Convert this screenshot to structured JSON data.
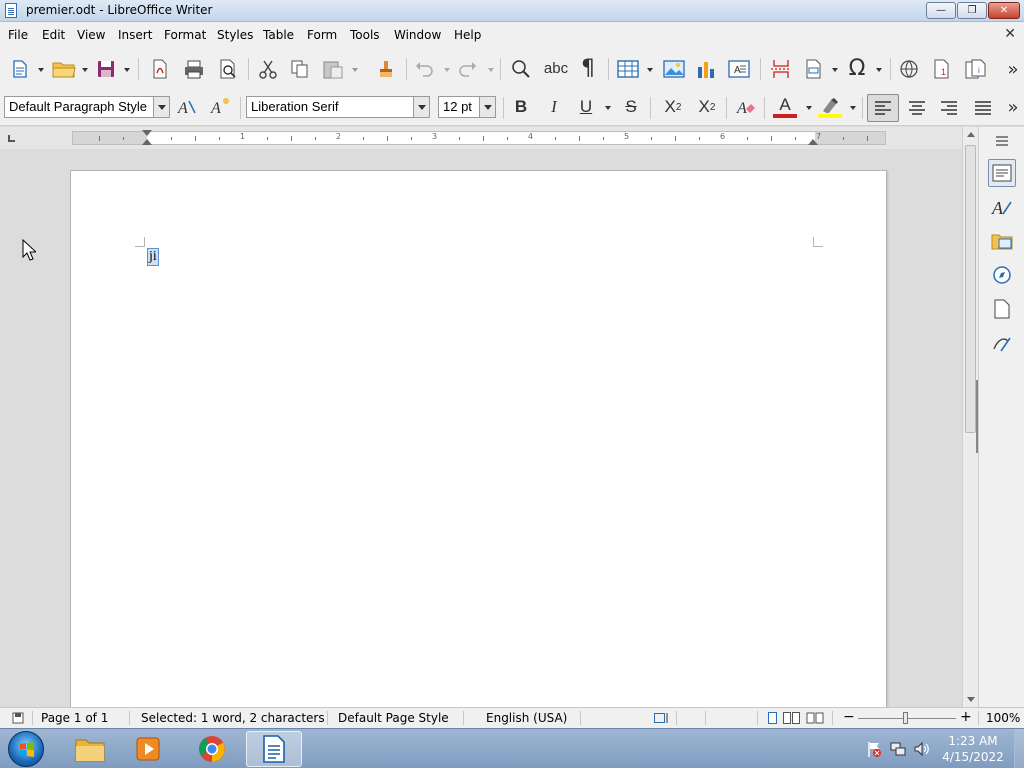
{
  "window": {
    "title": "premier.odt - LibreOffice Writer",
    "minimize_glyph": "—",
    "maximize_glyph": "❐",
    "close_glyph": "✕"
  },
  "menubar": {
    "items": [
      "File",
      "Edit",
      "View",
      "Insert",
      "Format",
      "Styles",
      "Table",
      "Form",
      "Tools",
      "Window",
      "Help"
    ],
    "close_glyph": "✕"
  },
  "toolbar": {
    "more_glyph": "»"
  },
  "formatting": {
    "paragraph_style": "Default Paragraph Style",
    "font_name": "Liberation Serif",
    "font_size": "12 pt",
    "bold_label": "B",
    "italic_label": "I",
    "underline_label": "U",
    "strikethrough_label": "S",
    "superscript_label": "X",
    "superscript_mark": "2",
    "subscript_label": "X",
    "subscript_mark": "2",
    "font_color_label": "A",
    "font_color": "#c9211e",
    "highlight_color": "#ffff00"
  },
  "ruler": {
    "numbers": [
      "1",
      "2",
      "3",
      "4",
      "5",
      "6",
      "7"
    ]
  },
  "document": {
    "selected_text": "ji"
  },
  "statusbar": {
    "page": "Page 1 of 1",
    "selection": "Selected: 1 word, 2 characters",
    "page_style": "Default Page Style",
    "language": "English (USA)",
    "zoom": "100%",
    "zoom_minus": "−",
    "zoom_plus": "+"
  },
  "taskbar": {
    "time": "1:23 AM",
    "date": "4/15/2022"
  }
}
